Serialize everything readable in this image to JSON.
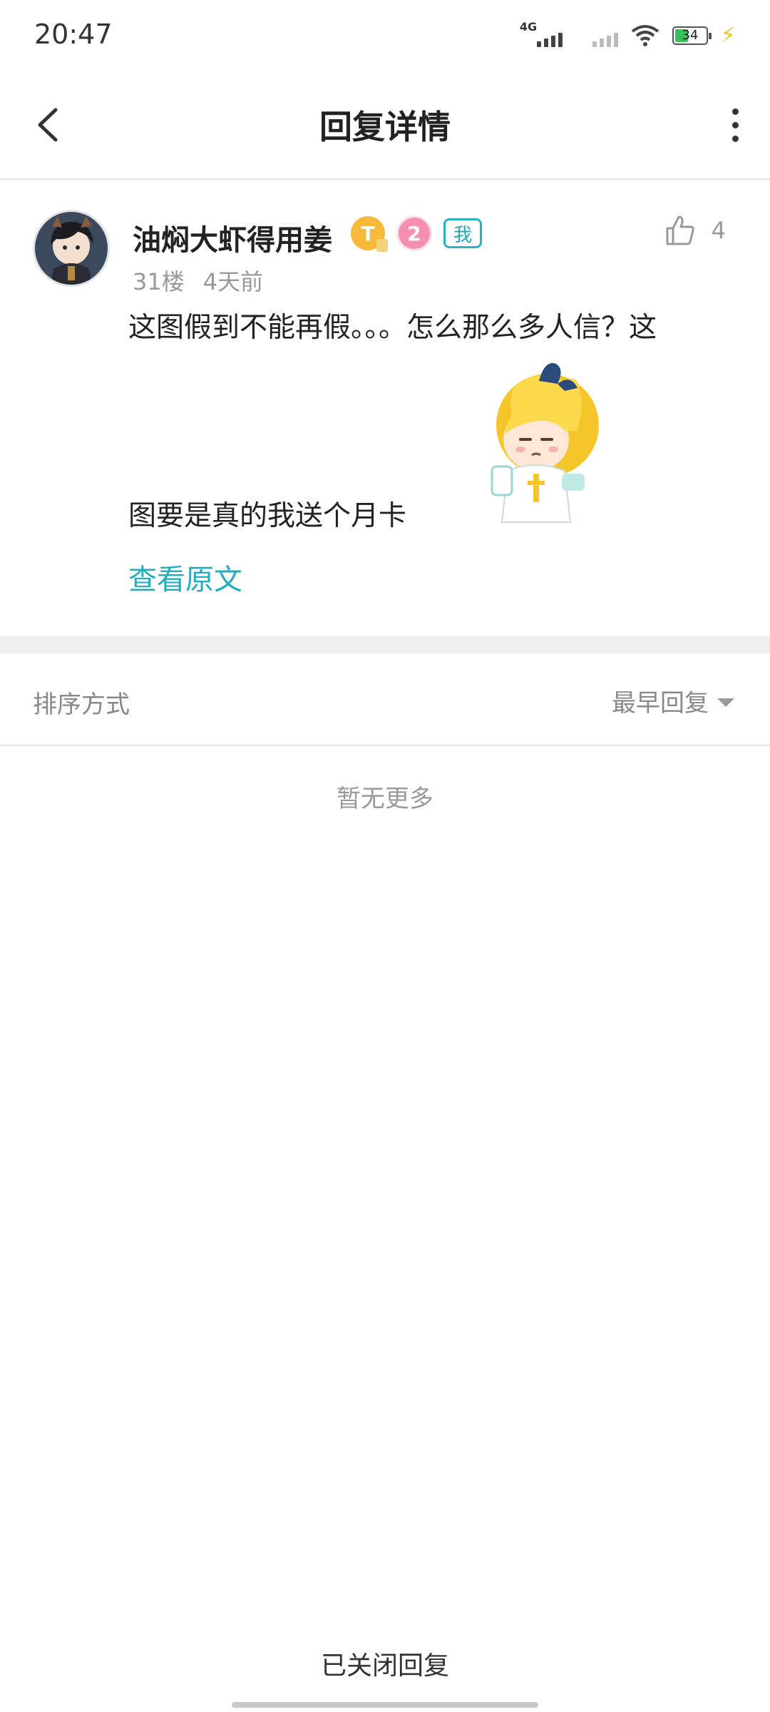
{
  "status_bar": {
    "time": "20:47",
    "network_label": "4G",
    "battery_level": "34",
    "icons": [
      "signal-icon",
      "signal-icon",
      "wifi-icon",
      "battery-icon",
      "charging-icon"
    ]
  },
  "header": {
    "title": "回复详情",
    "back_icon": "back-chevron-icon",
    "more_icon": "more-vertical-icon"
  },
  "comment": {
    "username": "油焖大虾得用姜",
    "badge_t": "T",
    "level": "2",
    "me_tag": "我",
    "likes": "4",
    "floor": "31楼",
    "time_ago": "4天前",
    "text_line1": "这图假到不能再假。。。怎么那么多人信？这",
    "text_line2": "图要是真的我送个月卡",
    "view_original": "查看原文"
  },
  "sort": {
    "label": "排序方式",
    "selected": "最早回复"
  },
  "empty_text": "暂无更多",
  "footer_text": "已关闭回复",
  "colors": {
    "accent": "#22aebd",
    "badge_gold": "#f7b93a",
    "badge_pink": "#f48fb1"
  }
}
